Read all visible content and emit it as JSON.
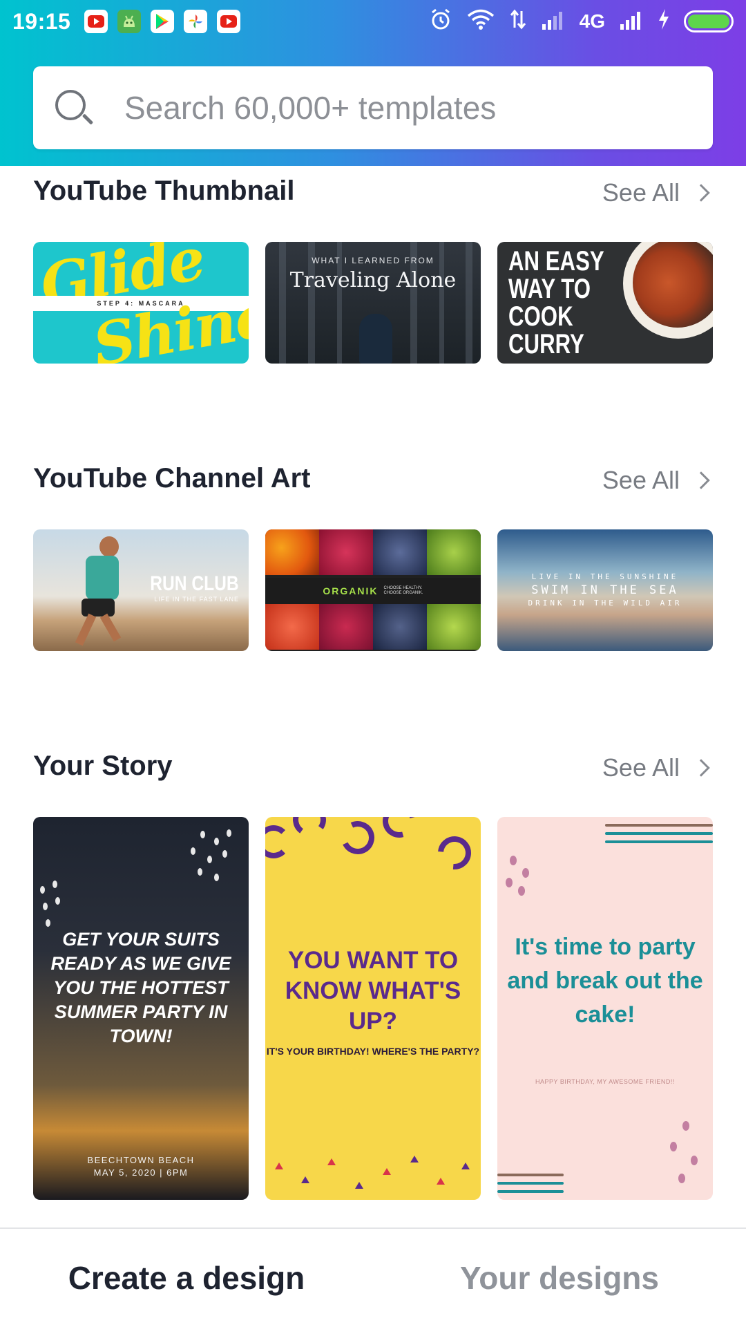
{
  "status_bar": {
    "time": "19:15",
    "network": "4G",
    "icons": [
      "youtube-icon",
      "android-icon",
      "play-store-icon",
      "photos-icon",
      "youtube-icon",
      "alarm-icon",
      "wifi-icon",
      "data-icon",
      "signal-icon",
      "signal-icon",
      "charging-icon",
      "battery-icon"
    ]
  },
  "search": {
    "placeholder": "Search 60,000+ templates"
  },
  "sections": [
    {
      "title": "YouTube Thumbnail",
      "see_all": "See All",
      "cards": [
        {
          "line1": "Glide",
          "line2": "Shine",
          "tag": "STEP 4: MASCARA"
        },
        {
          "small": "WHAT I LEARNED FROM",
          "big": "Traveling Alone"
        },
        {
          "lines": [
            "AN EASY",
            "WAY TO",
            "COOK",
            "CURRY"
          ]
        }
      ]
    },
    {
      "title": "YouTube Channel Art",
      "see_all": "See All",
      "cards": [
        {
          "title": "RUN CLUB",
          "sub": "LIFE IN THE FAST LANE"
        },
        {
          "name": "ORGANIK",
          "small1": "CHOOSE HEALTHY.",
          "small2": "CHOOSE ORGANIK."
        },
        {
          "line1": "LIVE IN THE SUNSHINE",
          "line2": "SWIM IN THE SEA",
          "line3": "DRINK IN THE WILD AIR"
        }
      ]
    },
    {
      "title": "Your Story",
      "see_all": "See All",
      "cards": [
        {
          "text": "GET YOUR SUITS READY AS WE GIVE YOU THE HOTTEST SUMMER PARTY IN TOWN!",
          "foot1": "BEECHTOWN BEACH",
          "foot2": "MAY 5, 2020 | 6PM"
        },
        {
          "big": "YOU WANT TO KNOW WHAT'S UP?",
          "small": "IT'S YOUR BIRTHDAY! WHERE'S THE PARTY?"
        },
        {
          "big": "It's time to party and break out the cake!",
          "small": "HAPPY BIRTHDAY, MY AWESOME FRIEND!!"
        }
      ]
    }
  ],
  "bottom_tabs": {
    "create": "Create a design",
    "yours": "Your designs"
  },
  "colors": {
    "gradient_start": "#00c3cf",
    "gradient_end": "#7d3ee6",
    "text_dark": "#1e2330",
    "text_muted": "#8f939a"
  }
}
